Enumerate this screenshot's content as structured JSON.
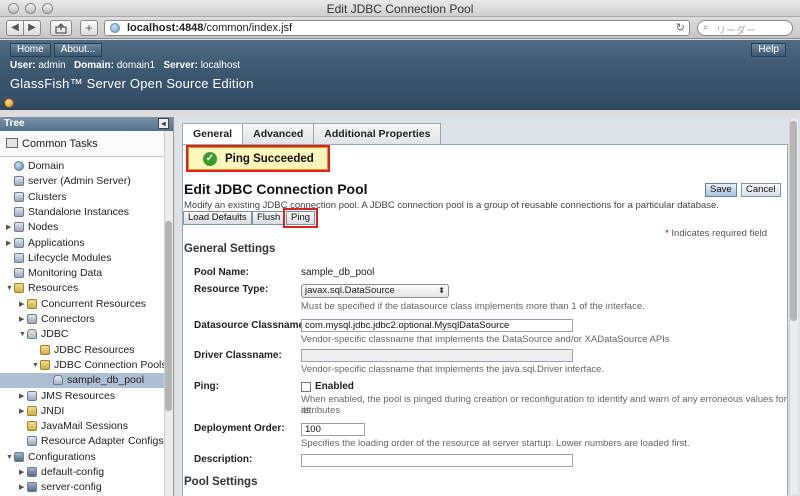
{
  "window": {
    "title": "Edit JDBC Connection Pool"
  },
  "browser": {
    "url_host": "localhost:4848",
    "url_path": "/common/index.jsf",
    "search_placeholder": "リーダー",
    "back": "◀",
    "forward": "▶",
    "plus": "+"
  },
  "masthead": {
    "home": "Home",
    "about": "About...",
    "help": "Help",
    "user_label": "User:",
    "user": "admin",
    "domain_label": "Domain:",
    "domain": "domain1",
    "server_label": "Server:",
    "server": "localhost",
    "product": "GlassFish™ Server Open Source Edition"
  },
  "tree": {
    "title": "Tree",
    "collapse": "◂",
    "common_tasks": "Common Tasks",
    "items": [
      {
        "label": "Domain",
        "exp": "",
        "icon": "globe"
      },
      {
        "label": "server (Admin Server)",
        "exp": "",
        "icon": "server"
      },
      {
        "label": "Clusters",
        "exp": "",
        "icon": "cluster"
      },
      {
        "label": "Standalone Instances",
        "exp": "",
        "icon": "instance"
      },
      {
        "label": "Nodes",
        "exp": "▶",
        "icon": "node"
      },
      {
        "label": "Applications",
        "exp": "▶",
        "icon": "application"
      },
      {
        "label": "Lifecycle Modules",
        "exp": "",
        "icon": "lifecycle"
      },
      {
        "label": "Monitoring Data",
        "exp": "",
        "icon": "monitoring"
      },
      {
        "label": "Resources",
        "exp": "▼",
        "icon": "folder"
      },
      {
        "label": "Concurrent Resources",
        "exp": "▶",
        "icon": "folder"
      },
      {
        "label": "Connectors",
        "exp": "▶",
        "icon": "connector"
      },
      {
        "label": "JDBC",
        "exp": "▼",
        "icon": "db"
      },
      {
        "label": "JDBC Resources",
        "exp": "",
        "icon": "folder"
      },
      {
        "label": "JDBC Connection Pools",
        "exp": "▼",
        "icon": "folder"
      },
      {
        "label": "sample_db_pool",
        "exp": "",
        "icon": "db"
      },
      {
        "label": "JMS Resources",
        "exp": "▶",
        "icon": "jms"
      },
      {
        "label": "JNDI",
        "exp": "▶",
        "icon": "folder"
      },
      {
        "label": "JavaMail Sessions",
        "exp": "",
        "icon": "folder"
      },
      {
        "label": "Resource Adapter Configs",
        "exp": "",
        "icon": "adapter"
      },
      {
        "label": "Configurations",
        "exp": "▼",
        "icon": "cfg"
      },
      {
        "label": "default-config",
        "exp": "▶",
        "icon": "cfg"
      },
      {
        "label": "server-config",
        "exp": "▶",
        "icon": "cfg"
      }
    ]
  },
  "tabs": [
    "General",
    "Advanced",
    "Additional Properties"
  ],
  "message": {
    "icon": "✓",
    "text": "Ping Succeeded"
  },
  "page": {
    "title": "Edit JDBC Connection Pool",
    "description": "Modify an existing JDBC connection pool. A JDBC connection pool is a group of reusable connections for a particular database.",
    "buttons": {
      "load_defaults": "Load Defaults",
      "flush": "Flush",
      "ping": "Ping",
      "save": "Save",
      "cancel": "Cancel"
    },
    "required_star": "*",
    "required_note": " Indicates required field",
    "section": "General Settings",
    "section2": "Pool Settings"
  },
  "form": {
    "pool_name": {
      "label": "Pool Name:",
      "value": "sample_db_pool"
    },
    "resource_type": {
      "label": "Resource Type:",
      "value": "javax.sql.DataSource",
      "help": "Must be specified if the datasource class implements more than 1 of the interface."
    },
    "datasource": {
      "label": "Datasource Classname:",
      "value": "com.mysql.jdbc.jdbc2.optional.MysqlDataSource",
      "help": "Vendor-specific classname that implements the DataSource and/or XADataSource APIs"
    },
    "driver": {
      "label": "Driver Classname:",
      "value": "",
      "help": "Vendor-specific classname that implements the java.sql.Driver interface."
    },
    "ping": {
      "label": "Ping:",
      "checkbox": "Enabled",
      "help1": "When enabled, the pool is pinged during creation or reconfiguration to identify and warn of any erroneous values for its",
      "help2": "attributes"
    },
    "deployment_order": {
      "label": "Deployment Order:",
      "value": "100",
      "help": "Specifies the loading order of the resource at server startup. Lower numbers are loaded first."
    },
    "description": {
      "label": "Description:",
      "value": ""
    }
  }
}
